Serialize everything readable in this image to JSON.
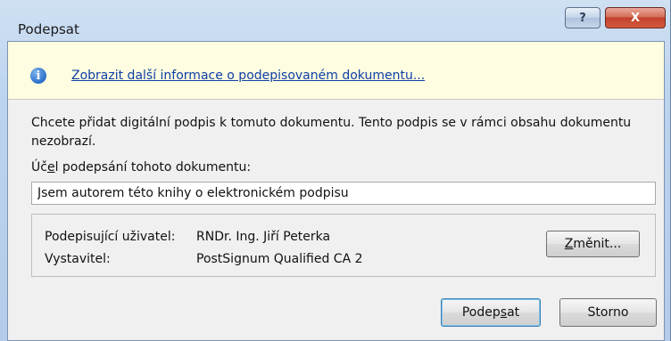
{
  "window": {
    "title": "Podepsat",
    "help_glyph": "?",
    "close_glyph": "X"
  },
  "infobar": {
    "icon": "info-icon",
    "icon_glyph": "i",
    "link_text": "Zobrazit další informace o podepisovaném dokumentu..."
  },
  "description": "Chcete přidat digitální podpis k tomuto dokumentu. Tento podpis se v rámci obsahu dokumentu nezobrazí.",
  "purpose": {
    "label_pre": "Úč",
    "label_accel": "e",
    "label_post": "l podepsání tohoto dokumentu:",
    "value": "Jsem autorem této knihy o elektronickém podpisu"
  },
  "signer": {
    "signer_label": "Podepisující uživatel:",
    "signer_value": "RNDr. Ing. Jiří Peterka",
    "issuer_label": "Vystavitel:",
    "issuer_value": "PostSignum Qualified CA 2",
    "change_accel": "Z",
    "change_rest": "měnit..."
  },
  "buttons": {
    "sign_pre": "Podep",
    "sign_accel": "s",
    "sign_post": "at",
    "cancel": "Storno"
  },
  "colors": {
    "link": "#0d3fa6",
    "infobar_bg": "#fffde1",
    "close_button": "#c2402a"
  }
}
